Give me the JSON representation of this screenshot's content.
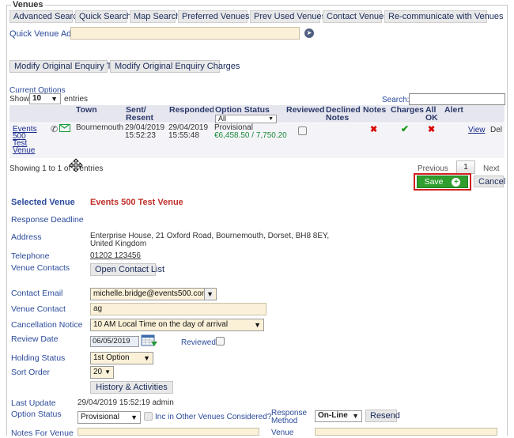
{
  "fieldset": {
    "legend": "Venues"
  },
  "tabs": [
    {
      "label": "Advanced Search"
    },
    {
      "label": "Quick Search"
    },
    {
      "label": "Map Search"
    },
    {
      "label": "Preferred Venues"
    },
    {
      "label": "Prev Used Venues"
    },
    {
      "label": "Contact Venues"
    },
    {
      "label": "Re-communicate with Venues"
    }
  ],
  "quick_add": {
    "label": "Quick Venue Add:",
    "value": ""
  },
  "modify": {
    "text_label": "Modify Original Enquiry Text",
    "charges_label": "Modify Original Enquiry Charges"
  },
  "options": {
    "title": "Current Options",
    "show_label": "Show",
    "show_value": "10",
    "entries_label": "entries",
    "search_label": "Search:",
    "search_value": ""
  },
  "table": {
    "headers": {
      "town": "Town",
      "sent": "Sent/ Resent",
      "responded": "Responded",
      "option_status": "Option Status",
      "option_filter": "All",
      "reviewed": "Reviewed",
      "declined": "Declined Notes",
      "notes": "Notes",
      "charges": "Charges",
      "all_ok": "All OK",
      "alert": "Alert"
    },
    "row": {
      "venue": "Events 500 Test Venue",
      "town": "Bournemouth",
      "sent": "29/04/2019 15:52:23",
      "responded": "29/04/2019 15:55:48",
      "status": "Provisional",
      "amount": "€6,458.50 / 7,750.20",
      "view": "View",
      "del": "Del"
    },
    "info": "Showing 1 to 1 of 1 entries",
    "prev": "Previous",
    "page": "1",
    "next": "Next"
  },
  "actions": {
    "save": "Save",
    "cancel": "Cancel"
  },
  "detail": {
    "selected_venue_label": "Selected Venue",
    "selected_venue": "Events 500 Test Venue",
    "response_deadline_label": "Response Deadline",
    "address_label": "Address",
    "address": "Enterprise House, 21 Oxford Road, Bournemouth, Dorset, BH8 8EY, United Kingdom",
    "telephone_label": "Telephone",
    "telephone": "01202 123456",
    "venue_contacts_label": "Venue Contacts",
    "open_contact_list": "Open Contact List",
    "contact_email_label": "Contact Email",
    "contact_email": "michelle.bridge@events500.com",
    "venue_contact_label": "Venue Contact",
    "venue_contact": "ag",
    "cancellation_label": "Cancellation Notice",
    "cancellation": "10 AM Local Time on the day of arrival",
    "review_date_label": "Review Date",
    "review_date": "06/05/2019",
    "reviewed_label": "Reviewed",
    "holding_status_label": "Holding Status",
    "holding_status": "1st Option",
    "sort_order_label": "Sort Order",
    "sort_order": "20",
    "history_button": "History & Activities",
    "last_update_label": "Last Update",
    "last_update": "29/04/2019 15:52:19 admin",
    "option_status_label": "Option Status",
    "option_status": "Provisional",
    "inc_other_label": "Inc in Other Venues Considered?",
    "response_method_label": "Response Method",
    "response_method": "On-Line",
    "resend": "Resend",
    "notes_for_venue_label": "Notes For Venue",
    "venue_label": "Venue"
  },
  "colors": {
    "link": "#2a4a9a",
    "save_green": "#2f9e2f",
    "highlight_red": "#d02020",
    "venue_red": "#c0302a"
  }
}
